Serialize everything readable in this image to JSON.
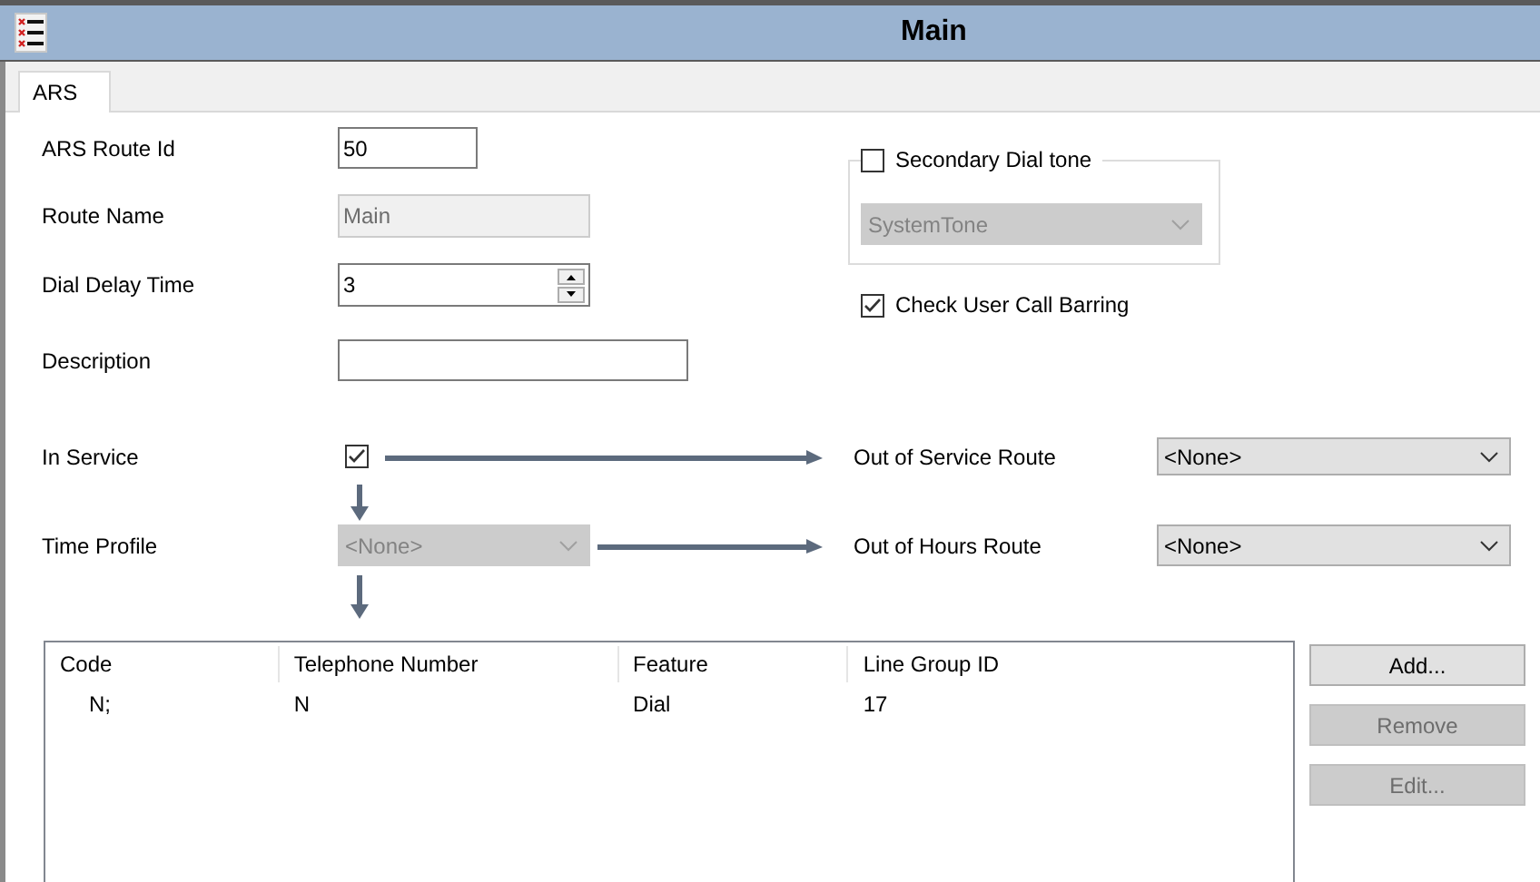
{
  "window": {
    "title": "Main"
  },
  "tabs": [
    {
      "label": "ARS",
      "selected": true
    }
  ],
  "route_id": {
    "label": "ARS Route Id",
    "value": "50",
    "disabled": false
  },
  "route_name": {
    "label": "Route Name",
    "value": "Main",
    "disabled": true
  },
  "dial_delay": {
    "label": "Dial Delay Time",
    "value": "3",
    "disabled": false
  },
  "description": {
    "label": "Description",
    "disabled": false
  },
  "secondary_dial_tone": {
    "label": "Secondary Dial tone",
    "checked": false,
    "value": "SystemTone",
    "disabled": true
  },
  "check_user_call_barring": {
    "label": "Check User Call Barring",
    "checked": true
  },
  "in_service": {
    "label": "In Service",
    "checked": true
  },
  "out_of_service_route": {
    "label": "Out of Service Route",
    "value": "<None>",
    "disabled": false
  },
  "time_profile": {
    "label": "Time Profile",
    "value": "<None>",
    "disabled": true
  },
  "out_of_hours_route": {
    "label": "Out of Hours Route",
    "value": "<None>",
    "disabled": false
  },
  "table": {
    "columns": [
      "Code",
      "Telephone Number",
      "Feature",
      "Line Group ID"
    ],
    "rows": [
      [
        "N;",
        "N",
        "Dial",
        "17"
      ]
    ]
  },
  "buttons": [
    {
      "label": "Add...",
      "disabled": false
    },
    {
      "label": "Remove",
      "disabled": true
    },
    {
      "label": "Edit...",
      "disabled": true
    }
  ]
}
